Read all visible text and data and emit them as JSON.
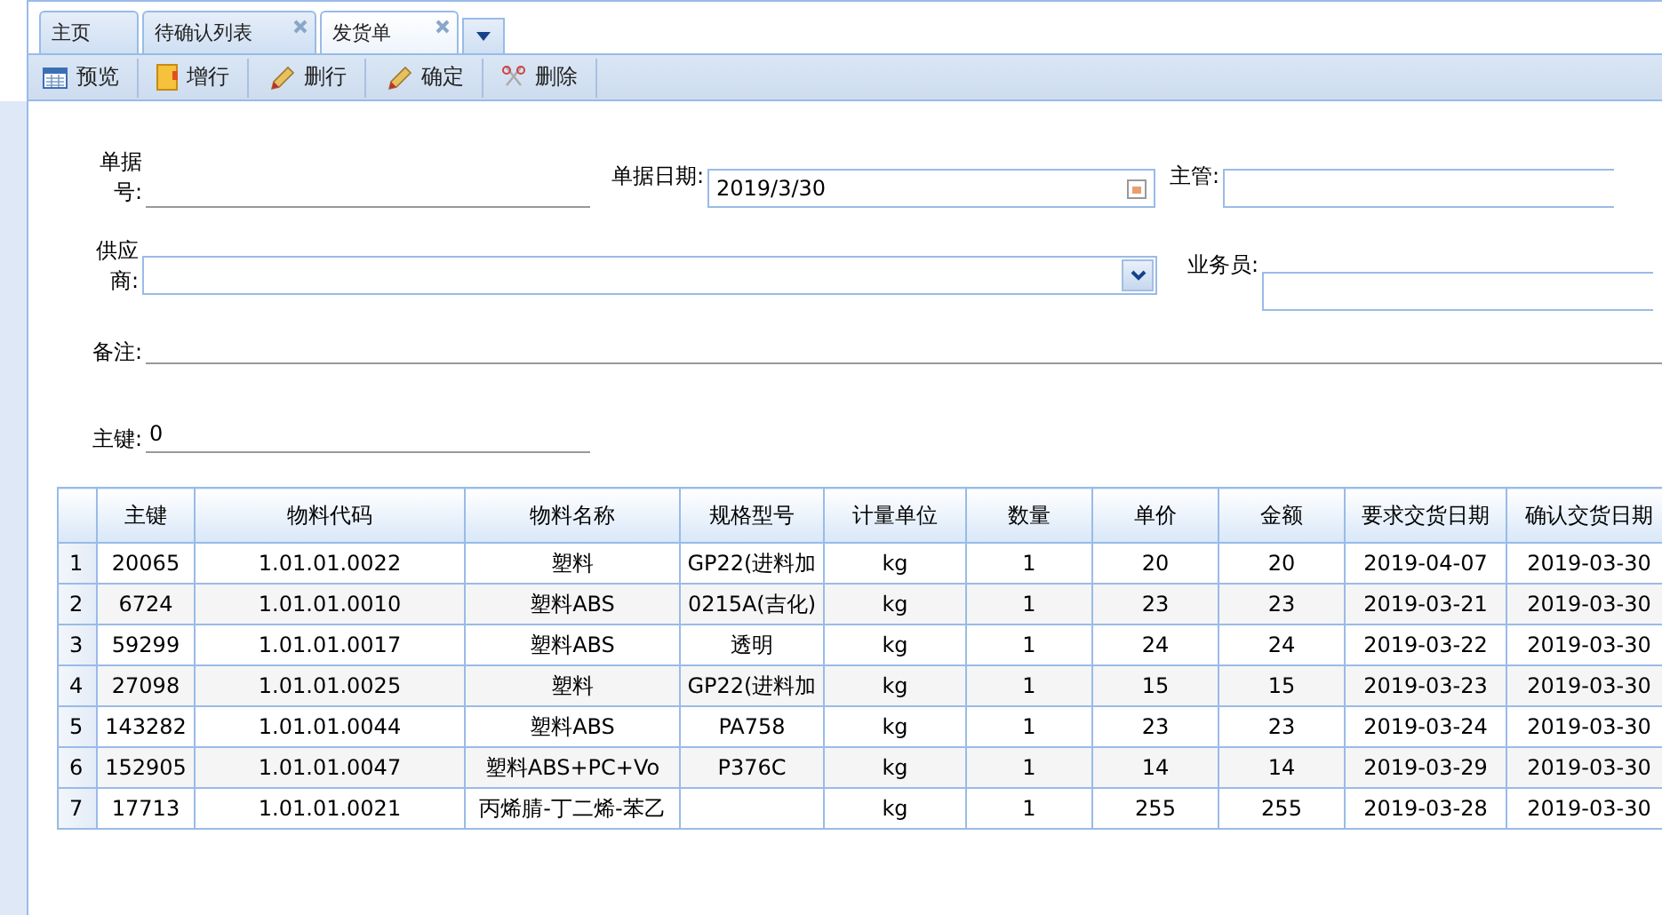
{
  "tabs": [
    {
      "label": "主页",
      "selected": false,
      "closable": false
    },
    {
      "label": "待确认列表",
      "selected": false,
      "closable": true
    },
    {
      "label": "发货单",
      "selected": true,
      "closable": true
    }
  ],
  "toolbar": [
    {
      "label": "预览",
      "kind": "preview"
    },
    {
      "label": "增行",
      "kind": "add"
    },
    {
      "label": "删行",
      "kind": "pencil"
    },
    {
      "label": "确定",
      "kind": "pencil"
    },
    {
      "label": "删除",
      "kind": "cut"
    }
  ],
  "form": {
    "bill_no": {
      "label": "单据号:"
    },
    "bill_date": {
      "label": "单据日期:",
      "value": "2019/3/30"
    },
    "manager": {
      "label": "主管:"
    },
    "supplier": {
      "label": "供应商:"
    },
    "salesman": {
      "label": "业务员:"
    },
    "remark": {
      "label": "备注:"
    },
    "key": {
      "label": "主键:",
      "value": "0"
    }
  },
  "table": {
    "columns": [
      "主键",
      "物料代码",
      "物料名称",
      "规格型号",
      "计量单位",
      "数量",
      "单价",
      "金额",
      "要求交货日期",
      "确认交货日期"
    ],
    "rows": [
      {
        "num": "1",
        "cells": [
          "20065",
          "1.01.01.0022",
          "塑料",
          "GP22(进料加",
          "kg",
          "1",
          "20",
          "20",
          "2019-04-07",
          "2019-03-30"
        ]
      },
      {
        "num": "2",
        "cells": [
          "6724",
          "1.01.01.0010",
          "塑料ABS",
          "0215A(吉化)",
          "kg",
          "1",
          "23",
          "23",
          "2019-03-21",
          "2019-03-30"
        ]
      },
      {
        "num": "3",
        "cells": [
          "59299",
          "1.01.01.0017",
          "塑料ABS",
          "透明",
          "kg",
          "1",
          "24",
          "24",
          "2019-03-22",
          "2019-03-30"
        ]
      },
      {
        "num": "4",
        "cells": [
          "27098",
          "1.01.01.0025",
          "塑料",
          "GP22(进料加",
          "kg",
          "1",
          "15",
          "15",
          "2019-03-23",
          "2019-03-30"
        ]
      },
      {
        "num": "5",
        "cells": [
          "143282",
          "1.01.01.0044",
          "塑料ABS",
          "PA758",
          "kg",
          "1",
          "23",
          "23",
          "2019-03-24",
          "2019-03-30"
        ]
      },
      {
        "num": "6",
        "cells": [
          "152905",
          "1.01.01.0047",
          "塑料ABS+PC+Vo",
          "P376C",
          "kg",
          "1",
          "14",
          "14",
          "2019-03-29",
          "2019-03-30"
        ]
      },
      {
        "num": "7",
        "cells": [
          "17713",
          "1.01.01.0021",
          "丙烯腈-丁二烯-苯乙",
          "",
          "kg",
          "1",
          "255",
          "255",
          "2019-03-28",
          "2019-03-30"
        ]
      }
    ]
  }
}
